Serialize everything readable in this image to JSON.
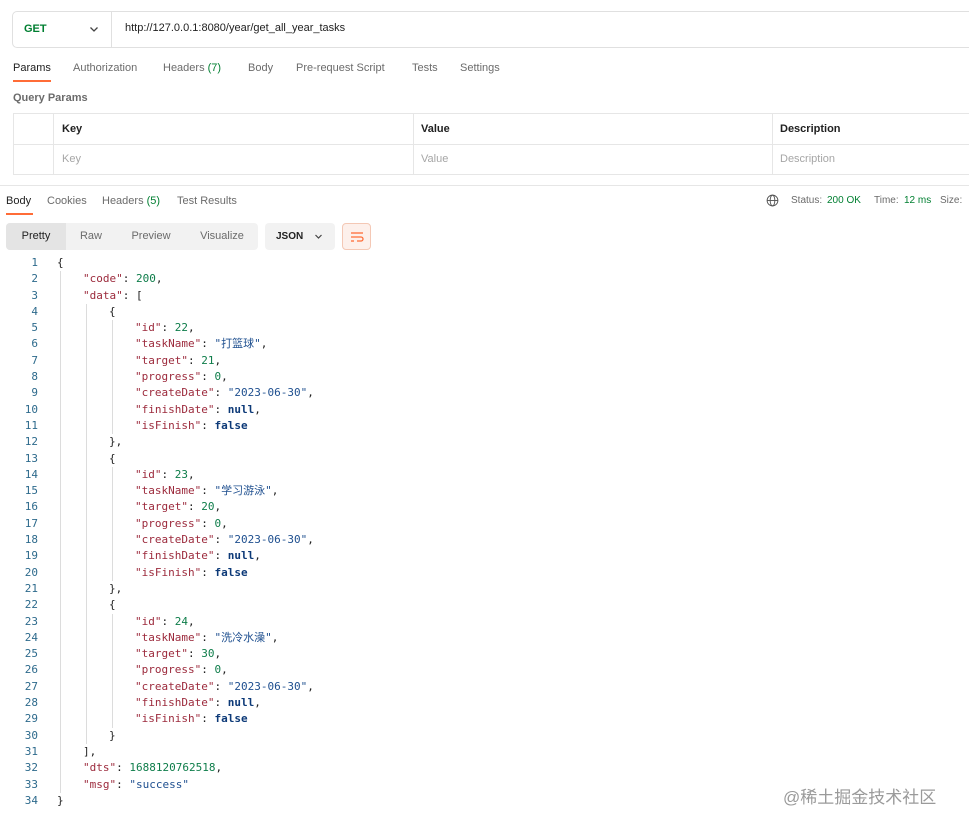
{
  "request": {
    "method": "GET",
    "url": "http://127.0.0.1:8080/year/get_all_year_tasks"
  },
  "request_tabs": {
    "params": "Params",
    "authorization": "Authorization",
    "headers": "Headers",
    "headers_count": "(7)",
    "body": "Body",
    "pre_request": "Pre-request Script",
    "tests": "Tests",
    "settings": "Settings"
  },
  "query_params": {
    "title": "Query Params",
    "columns": [
      "Key",
      "Value",
      "Description"
    ],
    "placeholders": [
      "Key",
      "Value",
      "Description"
    ]
  },
  "response_tabs": {
    "body": "Body",
    "cookies": "Cookies",
    "headers": "Headers",
    "headers_count": "(5)",
    "test_results": "Test Results"
  },
  "response_status": {
    "status_label": "Status:",
    "status_value": "200 OK",
    "time_label": "Time:",
    "time_value": "12 ms",
    "size_label": "Size:"
  },
  "view_modes": {
    "pretty": "Pretty",
    "raw": "Raw",
    "preview": "Preview",
    "visualize": "Visualize",
    "format": "JSON"
  },
  "code_lines": [
    "{",
    "\"code\": 200,",
    "\"data\": [",
    "{",
    "\"id\": 22,",
    "\"taskName\": \"打篮球\",",
    "\"target\": 21,",
    "\"progress\": 0,",
    "\"createDate\": \"2023-06-30\",",
    "\"finishDate\": null,",
    "\"isFinish\": false",
    "},",
    "{",
    "\"id\": 23,",
    "\"taskName\": \"学习游泳\",",
    "\"target\": 20,",
    "\"progress\": 0,",
    "\"createDate\": \"2023-06-30\",",
    "\"finishDate\": null,",
    "\"isFinish\": false",
    "},",
    "{",
    "\"id\": 24,",
    "\"taskName\": \"洗冷水澡\",",
    "\"target\": 30,",
    "\"progress\": 0,",
    "\"createDate\": \"2023-06-30\",",
    "\"finishDate\": null,",
    "\"isFinish\": false",
    "}",
    "],",
    "\"dts\": 1688120762518,",
    "\"msg\": \"success\"",
    "}"
  ],
  "watermark": "@稀土掘金技术社区",
  "colors": {
    "accent": "#ff6c37",
    "method_get": "#007f31",
    "json_key": "#9c2a3c",
    "json_number": "#0e7d4a",
    "json_string": "#1e4f8f",
    "json_keyword": "#0d3a78"
  }
}
